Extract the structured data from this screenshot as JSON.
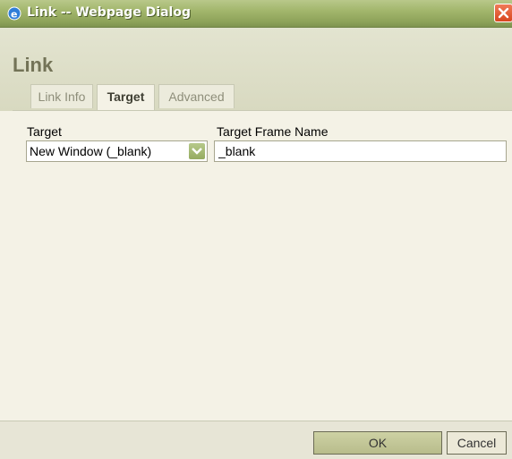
{
  "window": {
    "title": "Link -- Webpage Dialog"
  },
  "dialog": {
    "title": "Link",
    "tabs": [
      {
        "label": "Link Info",
        "active": false
      },
      {
        "label": "Target",
        "active": true
      },
      {
        "label": "Advanced",
        "active": false
      }
    ]
  },
  "target_panel": {
    "target_label": "Target",
    "target_value": "New Window (_blank)",
    "frame_name_label": "Target Frame Name",
    "frame_name_value": "_blank"
  },
  "footer": {
    "ok_label": "OK",
    "cancel_label": "Cancel"
  },
  "colors": {
    "titlebar": "#a2b66c",
    "header_bg": "#dcdcc5",
    "content_bg": "#f4f2e6",
    "close_button": "#e0532b"
  }
}
